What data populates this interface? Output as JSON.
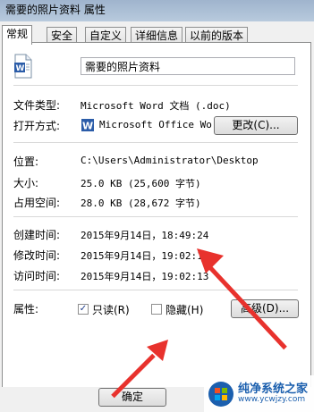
{
  "window": {
    "title": "需要的照片资料 属性"
  },
  "tabs": [
    {
      "label": "常规",
      "active": true
    },
    {
      "label": "安全"
    },
    {
      "label": "自定义"
    },
    {
      "label": "详细信息"
    },
    {
      "label": "以前的版本"
    }
  ],
  "general": {
    "file_name": "需要的照片资料",
    "file_type_label": "文件类型:",
    "file_type_value": "Microsoft Word 文档 (.doc)",
    "open_with_label": "打开方式:",
    "open_with_value": "Microsoft Office Wo",
    "change_button": "更改(C)...",
    "location_label": "位置:",
    "location_value": "C:\\Users\\Administrator\\Desktop",
    "size_label": "大小:",
    "size_value": "25.0 KB (25,600 字节)",
    "size_on_disk_label": "占用空间:",
    "size_on_disk_value": "28.0 KB (28,672 字节)",
    "created_label": "创建时间:",
    "created_value": "2015年9月14日，18:49:24",
    "modified_label": "修改时间:",
    "modified_value": "2015年9月14日，19:02:13",
    "accessed_label": "访问时间:",
    "accessed_value": "2015年9月14日，19:02:13",
    "attributes_label": "属性:",
    "readonly_label": "只读(R)",
    "readonly_checked": true,
    "hidden_label": "隐藏(H)",
    "hidden_checked": false,
    "advanced_button": "高级(D)..."
  },
  "footer": {
    "ok_button": "确定"
  },
  "watermark": {
    "title": "纯净系统之家",
    "url": "www.ycwjzy.com"
  },
  "colors": {
    "arrow": "#e8322d",
    "titlebar": "#b8cadd",
    "watermark": "#1b5fae"
  }
}
